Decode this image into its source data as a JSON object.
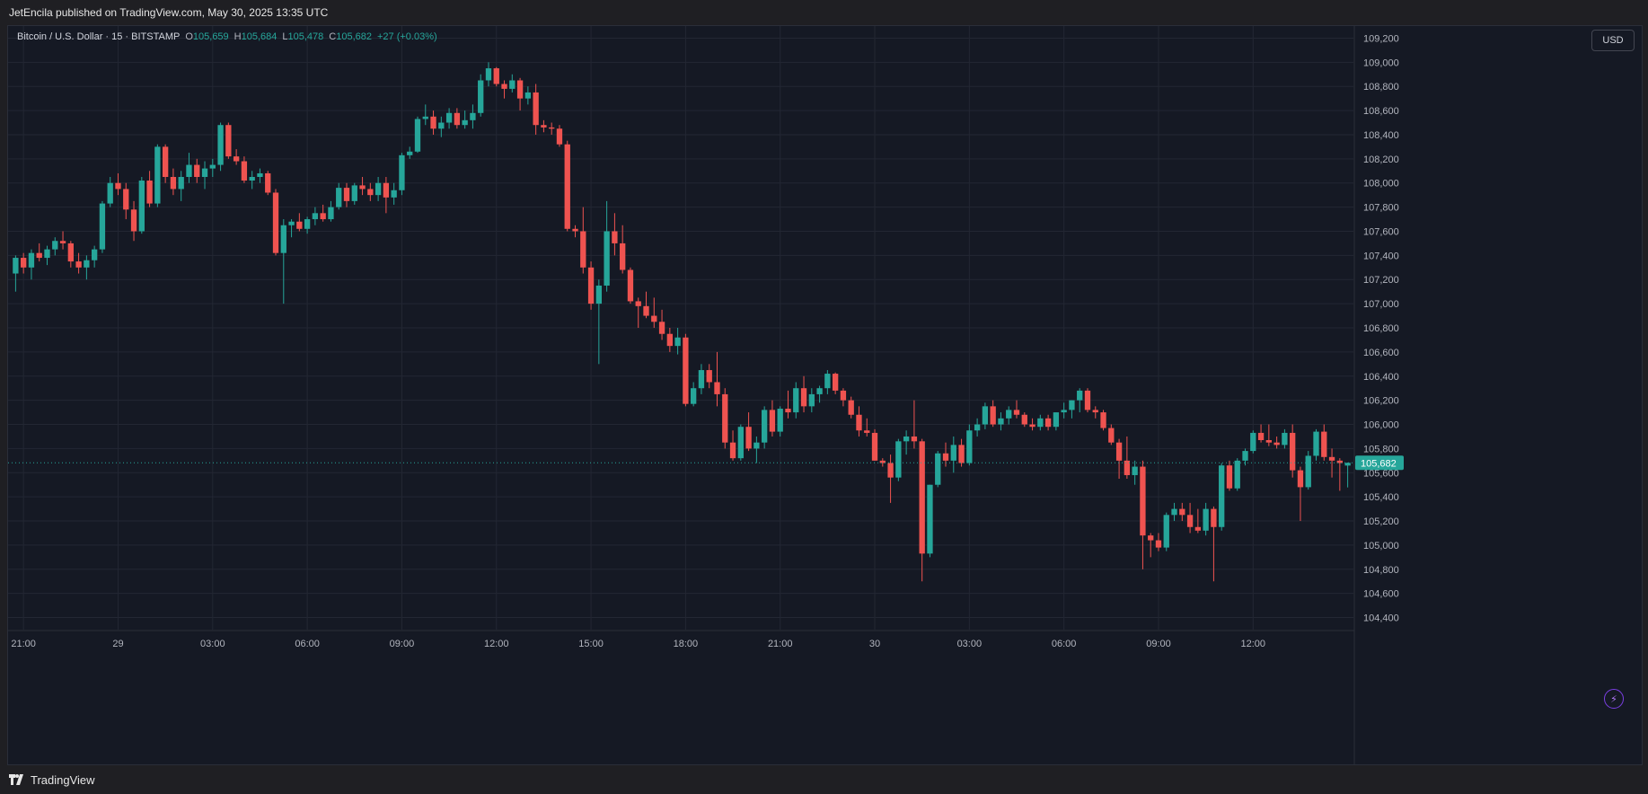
{
  "header": {
    "published": "JetEncila published on TradingView.com, May 30, 2025 13:35 UTC"
  },
  "legend": {
    "symbol": "Bitcoin / U.S. Dollar · 15 · BITSTAMP",
    "o_label": "O",
    "o": "105,659",
    "h_label": "H",
    "h": "105,684",
    "l_label": "L",
    "l": "105,478",
    "c_label": "C",
    "c": "105,682",
    "change": "+27 (+0.03%)"
  },
  "currency_button": "USD",
  "footer": {
    "brand": "TradingView"
  },
  "colors": {
    "up": "#26a69a",
    "down": "#ef5350",
    "bg": "#151924",
    "grid": "#232733",
    "price_tag": "#26a69a"
  },
  "chart_data": {
    "type": "candlestick",
    "title": "Bitcoin / U.S. Dollar · 15 · BITSTAMP",
    "ylim": [
      104300,
      109300
    ],
    "y_ticks": [
      104400,
      104600,
      104800,
      105000,
      105200,
      105400,
      105600,
      105800,
      106000,
      106200,
      106400,
      106600,
      106800,
      107000,
      107200,
      107400,
      107600,
      107800,
      108000,
      108200,
      108400,
      108600,
      108800,
      109000,
      109200
    ],
    "y_tick_labels": [
      "104,400",
      "104,600",
      "104,800",
      "105,000",
      "105,200",
      "105,400",
      "105,600",
      "105,800",
      "106,000",
      "106,200",
      "106,400",
      "106,600",
      "106,800",
      "107,000",
      "107,200",
      "107,400",
      "107,600",
      "107,800",
      "108,000",
      "108,200",
      "108,400",
      "108,600",
      "108,800",
      "109,000",
      "109,200"
    ],
    "x_ticks": [
      {
        "label": "21:00",
        "t": 1
      },
      {
        "label": "29",
        "t": 13
      },
      {
        "label": "03:00",
        "t": 25
      },
      {
        "label": "06:00",
        "t": 37
      },
      {
        "label": "09:00",
        "t": 49
      },
      {
        "label": "12:00",
        "t": 61
      },
      {
        "label": "15:00",
        "t": 73
      },
      {
        "label": "18:00",
        "t": 85
      },
      {
        "label": "21:00",
        "t": 97
      },
      {
        "label": "30",
        "t": 109
      },
      {
        "label": "03:00",
        "t": 121
      },
      {
        "label": "06:00",
        "t": 133
      },
      {
        "label": "09:00",
        "t": 145
      },
      {
        "label": "12:00",
        "t": 157
      }
    ],
    "last_price": 105682,
    "last_price_label": "105,682",
    "candles": [
      [
        107250,
        107400,
        107100,
        107380
      ],
      [
        107380,
        107420,
        107250,
        107300
      ],
      [
        107300,
        107450,
        107200,
        107420
      ],
      [
        107420,
        107500,
        107350,
        107380
      ],
      [
        107380,
        107480,
        107320,
        107450
      ],
      [
        107450,
        107550,
        107400,
        107520
      ],
      [
        107520,
        107600,
        107450,
        107500
      ],
      [
        107500,
        107520,
        107300,
        107350
      ],
      [
        107350,
        107420,
        107250,
        107300
      ],
      [
        107300,
        107400,
        107200,
        107360
      ],
      [
        107360,
        107480,
        107300,
        107450
      ],
      [
        107450,
        107850,
        107420,
        107830
      ],
      [
        107830,
        108050,
        107800,
        108000
      ],
      [
        108000,
        108080,
        107900,
        107950
      ],
      [
        107950,
        108000,
        107700,
        107780
      ],
      [
        107780,
        107850,
        107520,
        107600
      ],
      [
        107600,
        108050,
        107580,
        108020
      ],
      [
        108020,
        108100,
        107800,
        107830
      ],
      [
        107830,
        108320,
        107800,
        108300
      ],
      [
        108300,
        108320,
        108000,
        108050
      ],
      [
        108050,
        108120,
        107900,
        107950
      ],
      [
        107950,
        108100,
        107850,
        108050
      ],
      [
        108050,
        108250,
        108000,
        108150
      ],
      [
        108150,
        108200,
        108000,
        108050
      ],
      [
        108050,
        108180,
        107950,
        108120
      ],
      [
        108120,
        108200,
        108050,
        108150
      ],
      [
        108150,
        108500,
        108100,
        108480
      ],
      [
        108480,
        108500,
        108200,
        108220
      ],
      [
        108220,
        108280,
        108150,
        108180
      ],
      [
        108180,
        108220,
        108000,
        108020
      ],
      [
        108020,
        108100,
        107950,
        108050
      ],
      [
        108050,
        108120,
        108000,
        108080
      ],
      [
        108080,
        108100,
        107900,
        107920
      ],
      [
        107920,
        107950,
        107400,
        107420
      ],
      [
        107420,
        107700,
        107000,
        107650
      ],
      [
        107650,
        107700,
        107550,
        107680
      ],
      [
        107680,
        107750,
        107600,
        107620
      ],
      [
        107620,
        107720,
        107580,
        107700
      ],
      [
        107700,
        107800,
        107650,
        107750
      ],
      [
        107750,
        107820,
        107680,
        107700
      ],
      [
        107700,
        107850,
        107680,
        107800
      ],
      [
        107800,
        108000,
        107780,
        107960
      ],
      [
        107960,
        108000,
        107800,
        107850
      ],
      [
        107850,
        108000,
        107820,
        107980
      ],
      [
        107980,
        108050,
        107900,
        107950
      ],
      [
        107950,
        108000,
        107850,
        107900
      ],
      [
        107900,
        108050,
        107850,
        108000
      ],
      [
        108000,
        108050,
        107750,
        107880
      ],
      [
        107880,
        108000,
        107820,
        107940
      ],
      [
        107940,
        108250,
        107900,
        108230
      ],
      [
        108230,
        108300,
        108200,
        108260
      ],
      [
        108260,
        108550,
        108250,
        108530
      ],
      [
        108530,
        108650,
        108480,
        108550
      ],
      [
        108550,
        108600,
        108400,
        108450
      ],
      [
        108450,
        108550,
        108380,
        108500
      ],
      [
        108500,
        108620,
        108450,
        108580
      ],
      [
        108580,
        108620,
        108450,
        108480
      ],
      [
        108480,
        108600,
        108450,
        108520
      ],
      [
        108520,
        108650,
        108450,
        108580
      ],
      [
        108580,
        108900,
        108550,
        108850
      ],
      [
        108850,
        109000,
        108800,
        108950
      ],
      [
        108950,
        108960,
        108800,
        108820
      ],
      [
        108820,
        108850,
        108700,
        108780
      ],
      [
        108780,
        108900,
        108750,
        108850
      ],
      [
        108850,
        108870,
        108600,
        108700
      ],
      [
        108700,
        108800,
        108650,
        108750
      ],
      [
        108750,
        108820,
        108400,
        108480
      ],
      [
        108480,
        108520,
        108420,
        108460
      ],
      [
        108460,
        108500,
        108400,
        108450
      ],
      [
        108450,
        108480,
        108300,
        108320
      ],
      [
        108320,
        108350,
        107600,
        107620
      ],
      [
        107620,
        107650,
        107550,
        107600
      ],
      [
        107600,
        107800,
        107250,
        107300
      ],
      [
        107300,
        107350,
        106950,
        107000
      ],
      [
        107000,
        107200,
        106500,
        107150
      ],
      [
        107150,
        107850,
        107100,
        107600
      ],
      [
        107600,
        107750,
        107400,
        107500
      ],
      [
        107500,
        107650,
        107250,
        107280
      ],
      [
        107280,
        107300,
        107000,
        107020
      ],
      [
        107020,
        107050,
        106800,
        106980
      ],
      [
        106980,
        107100,
        106880,
        106900
      ],
      [
        106900,
        107050,
        106800,
        106850
      ],
      [
        106850,
        106950,
        106700,
        106750
      ],
      [
        106750,
        106800,
        106600,
        106650
      ],
      [
        106650,
        106800,
        106580,
        106720
      ],
      [
        106720,
        106750,
        106150,
        106170
      ],
      [
        106170,
        106350,
        106150,
        106300
      ],
      [
        106300,
        106500,
        106250,
        106450
      ],
      [
        106450,
        106500,
        106300,
        106350
      ],
      [
        106350,
        106600,
        106150,
        106250
      ],
      [
        106250,
        106300,
        105800,
        105850
      ],
      [
        105850,
        105950,
        105700,
        105720
      ],
      [
        105720,
        106000,
        105700,
        105980
      ],
      [
        105980,
        106100,
        105780,
        105800
      ],
      [
        105800,
        105900,
        105680,
        105850
      ],
      [
        105850,
        106150,
        105800,
        106120
      ],
      [
        106120,
        106200,
        105900,
        105940
      ],
      [
        105940,
        106150,
        105900,
        106130
      ],
      [
        106130,
        106280,
        106050,
        106100
      ],
      [
        106100,
        106350,
        106050,
        106300
      ],
      [
        106300,
        106400,
        106100,
        106150
      ],
      [
        106150,
        106300,
        106100,
        106250
      ],
      [
        106250,
        106320,
        106180,
        106300
      ],
      [
        106300,
        106450,
        106250,
        106420
      ],
      [
        106420,
        106430,
        106250,
        106280
      ],
      [
        106280,
        106300,
        106150,
        106200
      ],
      [
        106200,
        106230,
        106050,
        106080
      ],
      [
        106080,
        106150,
        105900,
        105950
      ],
      [
        105950,
        106050,
        105900,
        105930
      ],
      [
        105930,
        105960,
        105700,
        105700
      ],
      [
        105700,
        105720,
        105650,
        105680
      ],
      [
        105680,
        105750,
        105350,
        105560
      ],
      [
        105560,
        105880,
        105530,
        105860
      ],
      [
        105860,
        105950,
        105750,
        105900
      ],
      [
        105900,
        106200,
        105800,
        105860
      ],
      [
        105860,
        105880,
        104700,
        104930
      ],
      [
        104930,
        105500,
        104900,
        105500
      ],
      [
        105500,
        105780,
        105480,
        105760
      ],
      [
        105760,
        105850,
        105650,
        105700
      ],
      [
        105700,
        105900,
        105600,
        105830
      ],
      [
        105830,
        105880,
        105650,
        105680
      ],
      [
        105680,
        106000,
        105660,
        105950
      ],
      [
        105950,
        106050,
        105900,
        106000
      ],
      [
        106000,
        106180,
        105960,
        106150
      ],
      [
        106150,
        106200,
        105980,
        106000
      ],
      [
        106000,
        106100,
        105950,
        106050
      ],
      [
        106050,
        106150,
        106000,
        106120
      ],
      [
        106120,
        106200,
        106050,
        106080
      ],
      [
        106080,
        106100,
        105980,
        106000
      ],
      [
        106000,
        106050,
        105950,
        105980
      ],
      [
        105980,
        106080,
        105950,
        106050
      ],
      [
        106050,
        106080,
        105950,
        105980
      ],
      [
        105980,
        106100,
        105950,
        106100
      ],
      [
        106100,
        106180,
        106050,
        106120
      ],
      [
        106120,
        106200,
        106050,
        106200
      ],
      [
        106200,
        106300,
        106100,
        106280
      ],
      [
        106280,
        106300,
        106100,
        106120
      ],
      [
        106120,
        106150,
        106050,
        106100
      ],
      [
        106100,
        106120,
        105950,
        105970
      ],
      [
        105970,
        106000,
        105830,
        105850
      ],
      [
        105850,
        105880,
        105550,
        105700
      ],
      [
        105700,
        105900,
        105550,
        105580
      ],
      [
        105580,
        105700,
        105500,
        105650
      ],
      [
        105650,
        105700,
        104800,
        105080
      ],
      [
        105080,
        105100,
        104900,
        105040
      ],
      [
        105040,
        105100,
        104950,
        104980
      ],
      [
        104980,
        105270,
        104950,
        105250
      ],
      [
        105250,
        105350,
        105200,
        105300
      ],
      [
        105300,
        105350,
        105200,
        105250
      ],
      [
        105250,
        105350,
        105100,
        105150
      ],
      [
        105150,
        105300,
        105100,
        105120
      ],
      [
        105120,
        105350,
        105080,
        105300
      ],
      [
        105300,
        105320,
        104700,
        105150
      ],
      [
        105150,
        105680,
        105120,
        105660
      ],
      [
        105660,
        105700,
        105450,
        105470
      ],
      [
        105470,
        105720,
        105450,
        105700
      ],
      [
        105700,
        105800,
        105660,
        105780
      ],
      [
        105780,
        105950,
        105760,
        105930
      ],
      [
        105930,
        106000,
        105850,
        105870
      ],
      [
        105870,
        106000,
        105820,
        105850
      ],
      [
        105850,
        105900,
        105800,
        105830
      ],
      [
        105830,
        105960,
        105800,
        105930
      ],
      [
        105930,
        106000,
        105560,
        105620
      ],
      [
        105620,
        105650,
        105200,
        105480
      ],
      [
        105480,
        105780,
        105460,
        105740
      ],
      [
        105740,
        105960,
        105700,
        105940
      ],
      [
        105940,
        106000,
        105700,
        105730
      ],
      [
        105730,
        105800,
        105560,
        105700
      ],
      [
        105700,
        105720,
        105450,
        105680
      ],
      [
        105659,
        105684,
        105478,
        105682
      ]
    ]
  }
}
